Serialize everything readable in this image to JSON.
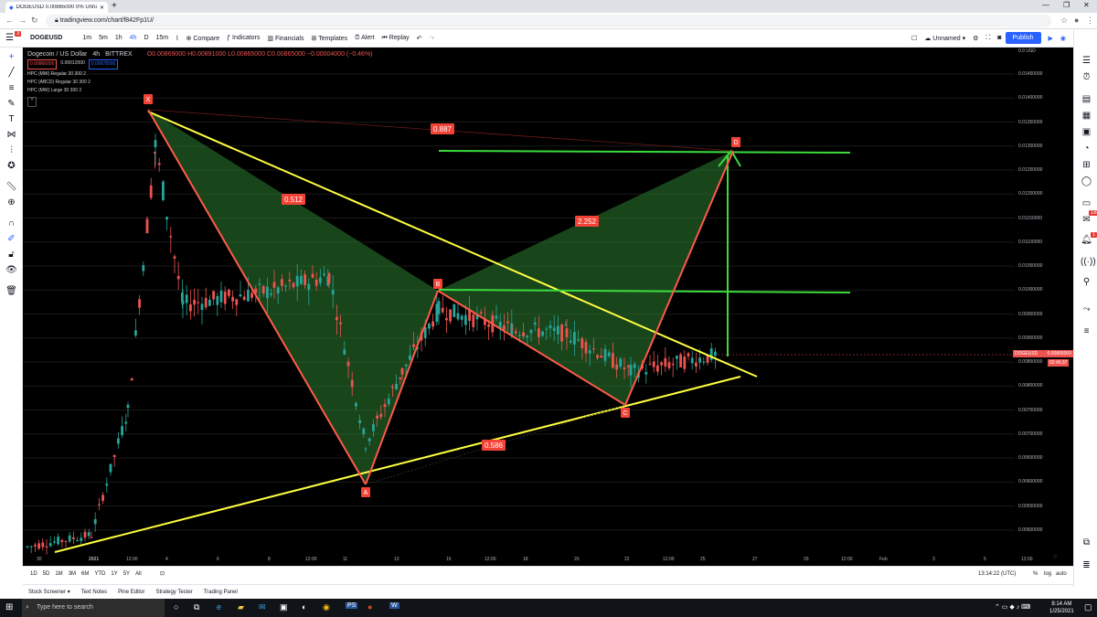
{
  "browser": {
    "tab_title": "DOGEUSD 0.00865000 0% Unna",
    "url": "tradingview.com/chart/f842Fp1U/"
  },
  "toolbar": {
    "symbol": "DOGEUSD",
    "intervals": [
      "1m",
      "5m",
      "1h",
      "4h",
      "D",
      "15m"
    ],
    "compare": "Compare",
    "indicators": "Indicators",
    "financials": "Financials",
    "templates": "Templates",
    "alert": "Alert",
    "replay": "Replay",
    "layout_name": "Unnamed",
    "publish": "Publish"
  },
  "legend": {
    "title": "Dogecoin / US Dollar",
    "interval": "4h",
    "exchange": "BITTREX",
    "ohlc": "O0.00869000 H0.00891000 L0.00865000 C0.00865000 −0.00004000 (−0.46%)",
    "bid": "0.00866000",
    "spread": "0.00012000",
    "ask": "0.00878000",
    "indicators": [
      "HPC (MW) Regular 30 300 2",
      "HPC (ABCD) Regular 30 300 2",
      "HPC (MW) Large 30 300 2"
    ]
  },
  "chart_data": {
    "type": "candlestick",
    "symbol": "DOGEUSD",
    "price_axis": [
      "0.01450000",
      "0.01400000",
      "0.01350000",
      "0.01300000",
      "0.01250000",
      "0.01200000",
      "0.01150000",
      "0.01100000",
      "0.01050000",
      "0.01000000",
      "0.00950000",
      "0.00900000",
      "0.00850000",
      "0.00800000",
      "0.00750000",
      "0.00700000",
      "0.00650000",
      "0.00600000",
      "0.00550000",
      "0.00500000"
    ],
    "price_top_label": "0.0",
    "price_unit": "USD",
    "time_axis": [
      "30",
      "2021",
      "12:00",
      "4",
      "6",
      "8",
      "12:00",
      "11",
      "13",
      "15",
      "12:00",
      "18",
      "20",
      "22",
      "12:00",
      "25",
      "27",
      "29",
      "12:00",
      "Feb",
      "3",
      "5",
      "12:00"
    ],
    "last_price": "0.00865000",
    "countdown": "02:45:37",
    "price_label_symbol": "DOGEUSD",
    "pattern_points": [
      {
        "label": "X",
        "price": 0.0137
      },
      {
        "label": "A",
        "price": 0.006
      },
      {
        "label": "B",
        "price": 0.01
      },
      {
        "label": "C",
        "price": 0.0076
      },
      {
        "label": "D",
        "price": 0.0129
      }
    ],
    "ratios": [
      "0.887",
      "0.512",
      "2.252",
      "0.586"
    ]
  },
  "bottom": {
    "ranges": [
      "1D",
      "5D",
      "1M",
      "3M",
      "6M",
      "YTD",
      "1Y",
      "5Y",
      "All"
    ],
    "clock": "13:14:22 (UTC)",
    "pct": "%",
    "log": "log",
    "auto": "auto"
  },
  "panels": [
    "Stock Screener",
    "Text Notes",
    "Pine Editor",
    "Strategy Tester",
    "Trading Panel"
  ],
  "taskbar": {
    "search": "Type here to search",
    "time": "8:14 AM",
    "date": "1/25/2021"
  },
  "notification_badges": [
    "3",
    "18",
    "1"
  ],
  "colors": {
    "up": "#26a69a",
    "down": "#ef5350",
    "pattern": "#2e7d32",
    "triangle": "#ffff40"
  }
}
